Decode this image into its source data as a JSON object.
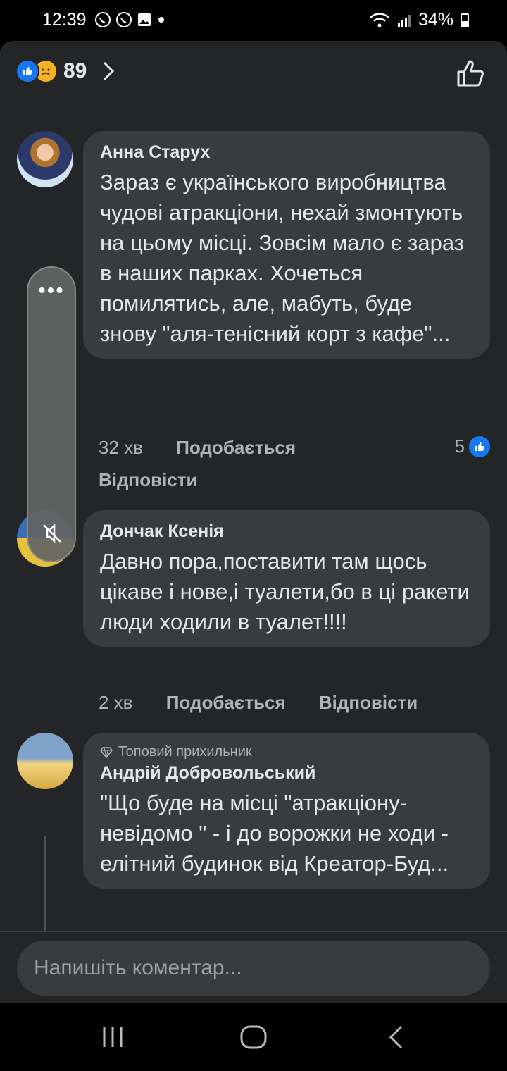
{
  "status": {
    "time": "12:39",
    "battery": "34%"
  },
  "reactions": {
    "count": "89"
  },
  "comments": [
    {
      "author": "Анна Старух",
      "text": "Зараз є українського виробництва чудові атракціони, нехай змонтують на цьому місці. Зовсім мало є зараз  в наших парках. Хочеться помилятись, але, мабуть, буде знову \"аля-тенісний корт з кафе\"...",
      "time": "32 хв",
      "like_label": "Подобається",
      "reply_label": "Відповісти",
      "like_count": "5"
    },
    {
      "author": "Дончак Ксенія",
      "text": "Давно пора,поставити там щось цікаве і нове,і туалети,бо в ці ракети люди ходили в туалет!!!!",
      "time": "2 хв",
      "like_label": "Подобається",
      "reply_label": "Відповісти"
    },
    {
      "badge": "Топовий прихильник",
      "author": "Андрій Добровольський",
      "text": "\"Що буде на місці \"атракціону-невідомо \" - і до ворожки не ходи - елітний будинок від Креатор-Буд..."
    }
  ],
  "input": {
    "placeholder": "Напишіть коментар..."
  },
  "icons": {
    "like": "like-icon",
    "sad": "sad-reaction-icon",
    "thumb": "thumbs-up-outline-icon",
    "chevron": "chevron-right-icon",
    "diamond": "diamond-icon",
    "mute": "mute-icon"
  },
  "colors": {
    "accent": "#1877f2",
    "bubble": "#3a3b3c",
    "background": "#242526"
  }
}
